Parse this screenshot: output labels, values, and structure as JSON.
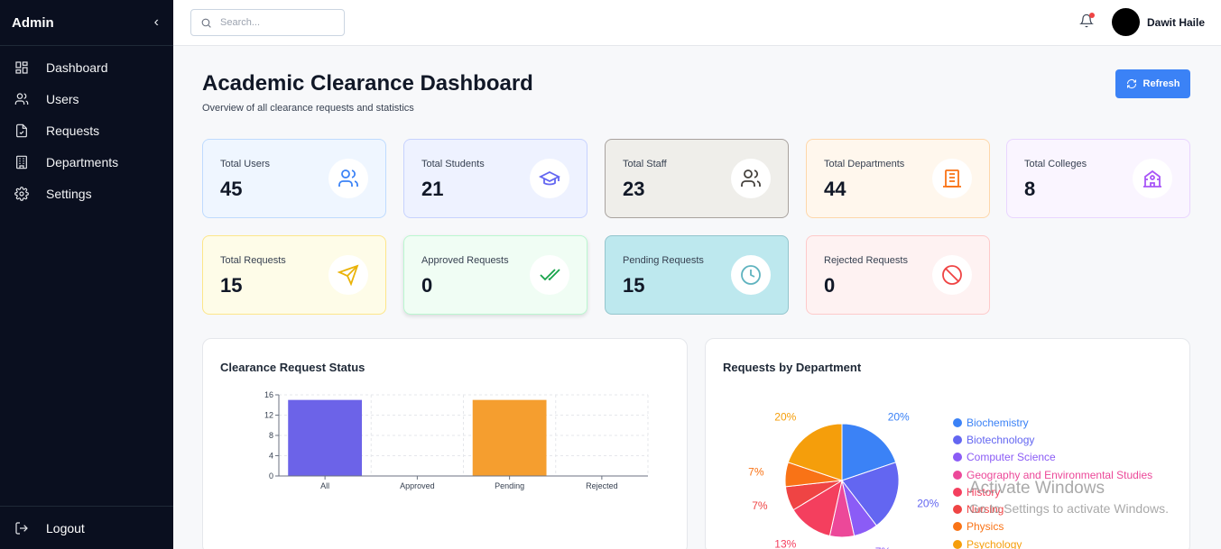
{
  "sidebar": {
    "title": "Admin",
    "items": [
      {
        "label": "Dashboard",
        "icon": "grid-icon"
      },
      {
        "label": "Users",
        "icon": "users-icon"
      },
      {
        "label": "Requests",
        "icon": "file-icon"
      },
      {
        "label": "Departments",
        "icon": "building-icon"
      },
      {
        "label": "Settings",
        "icon": "gear-icon"
      }
    ],
    "logout": "Logout"
  },
  "topbar": {
    "search_placeholder": "Search...",
    "username": "Dawit Haile"
  },
  "header": {
    "title": "Academic Clearance Dashboard",
    "subtitle": "Overview of all clearance requests and statistics",
    "refresh_label": "Refresh"
  },
  "cards": [
    {
      "label": "Total Users",
      "value": "45",
      "icon": "users-icon",
      "bg": "#eff6ff",
      "border": "#bfdbfe",
      "color": "#3b82f6"
    },
    {
      "label": "Total Students",
      "value": "21",
      "icon": "graduation-cap-icon",
      "bg": "#eef2ff",
      "border": "#c7d2fe",
      "color": "#6366f1"
    },
    {
      "label": "Total Staff",
      "value": "23",
      "icon": "users-icon",
      "bg": "#efeeea",
      "border": "#a8a29e",
      "color": "#44403c"
    },
    {
      "label": "Total Departments",
      "value": "44",
      "icon": "building-icon",
      "bg": "#fff7ed",
      "border": "#fed7aa",
      "color": "#f97316"
    },
    {
      "label": "Total Colleges",
      "value": "8",
      "icon": "school-icon",
      "bg": "#faf5ff",
      "border": "#e9d5ff",
      "color": "#a855f7"
    },
    {
      "label": "Total Requests",
      "value": "15",
      "icon": "send-icon",
      "bg": "#fefce8",
      "border": "#fde68a",
      "color": "#eab308"
    },
    {
      "label": "Approved Requests",
      "value": "0",
      "icon": "check-double-icon",
      "bg": "#f0fdf4",
      "border": "#bbf7d0",
      "color": "#16a34a"
    },
    {
      "label": "Pending Requests",
      "value": "15",
      "icon": "clock-icon",
      "bg": "#bde8ee",
      "border": "#93c5cd",
      "color": "#5fb3bf"
    },
    {
      "label": "Rejected Requests",
      "value": "0",
      "icon": "ban-icon",
      "bg": "#fef2f2",
      "border": "#fecaca",
      "color": "#ef4444"
    }
  ],
  "chart_data": [
    {
      "type": "bar",
      "title": "Clearance Request Status",
      "categories": [
        "All",
        "Approved",
        "Pending",
        "Rejected"
      ],
      "values": [
        15,
        0,
        15,
        0
      ],
      "colors": [
        "#6c63e8",
        "#6c63e8",
        "#f59e2f",
        "#6c63e8"
      ],
      "ylim": [
        0,
        16
      ],
      "yticks": [
        0,
        4,
        8,
        12,
        16
      ],
      "grid": true
    },
    {
      "type": "pie",
      "title": "Requests by Department",
      "labels": [
        "Biochemistry",
        "Biotechnology",
        "Computer Science",
        "Geography and Environmental Studies",
        "History",
        "Nursing",
        "Physics",
        "Psychology"
      ],
      "values": [
        20,
        20,
        7,
        7,
        13,
        7,
        7,
        20
      ],
      "colors": [
        "#3b82f6",
        "#6366f1",
        "#8b5cf6",
        "#ec4899",
        "#f43f5e",
        "#ef4444",
        "#f97316",
        "#f59e0b"
      ],
      "legend": "right"
    }
  ],
  "watermark": {
    "line1": "Activate Windows",
    "line2": "Go to Settings to activate Windows."
  }
}
